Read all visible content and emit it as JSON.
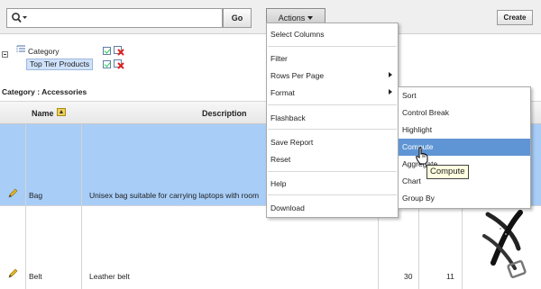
{
  "toolbar": {
    "search_value": "",
    "go_label": "Go",
    "actions_label": "Actions",
    "create_label": "Create"
  },
  "filters": {
    "items": [
      {
        "label": "Category"
      },
      {
        "label": "Top Tier Products"
      }
    ]
  },
  "report": {
    "category_label": "Category : Accessories",
    "columns": [
      "Name",
      "Description"
    ],
    "rows": [
      {
        "name": "Bag",
        "description": "Unisex bag suitable for carrying laptops with room",
        "selected": true
      },
      {
        "name": "Belt",
        "description": "Leather belt",
        "extra": [
          "30",
          "11"
        ]
      }
    ]
  },
  "actions_menu": {
    "groups": [
      [
        "Select Columns"
      ],
      [
        "Filter",
        "Rows Per Page",
        "Format"
      ],
      [
        "Flashback"
      ],
      [
        "Save Report",
        "Reset"
      ],
      [
        "Help"
      ],
      [
        "Download"
      ]
    ],
    "submenu_items": [
      "Rows Per Page",
      "Format"
    ]
  },
  "format_submenu": {
    "items": [
      "Sort",
      "Control Break",
      "Highlight",
      "Compute",
      "Aggregate",
      "Chart",
      "Group By"
    ],
    "active": "Compute"
  },
  "tooltip": {
    "text": "Compute"
  },
  "colors": {
    "selection": "#a8cdf7",
    "menu_active": "#5f95d4"
  }
}
